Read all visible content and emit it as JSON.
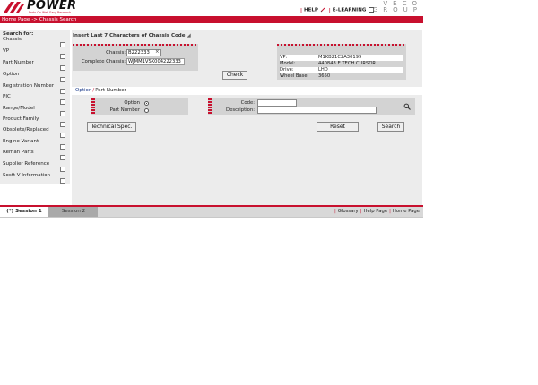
{
  "header": {
    "logo_text": "POWER",
    "logo_tagline": "Parts On Web Easy Research",
    "help_label": "HELP",
    "elearning_label": "E-LEARNING",
    "brand_logo_line1": "IVECO",
    "brand_logo_line2": "GROUP"
  },
  "breadcrumb": {
    "home": "Home Page",
    "arrow": "->",
    "current": "Chassis Search"
  },
  "sidebar": {
    "title": "Search for:",
    "items": [
      {
        "label": "Chassis"
      },
      {
        "label": "VP"
      },
      {
        "label": "Part Number"
      },
      {
        "label": "Option"
      },
      {
        "label": "Registration Number"
      },
      {
        "label": "PIC"
      },
      {
        "label": "Range/Model"
      },
      {
        "label": "Product Family"
      },
      {
        "label": "Obsolete/Replaced"
      },
      {
        "label": "Engine Variant"
      },
      {
        "label": "Reman Parts"
      },
      {
        "label": "Supplier Reference"
      },
      {
        "label": "Sostt V Information"
      }
    ]
  },
  "main": {
    "section_title": "Insert Last 7 Characters of Chassis Code",
    "chassis_label": "Chassis:",
    "chassis_value": "B222333",
    "clear_symbol": "×",
    "complete_chassis_label": "Complete Chassis:",
    "complete_chassis_value": "WJMM1VSK004222333",
    "check_button": "Check",
    "vehicle_info": [
      {
        "key": "VP:",
        "value": "M1KB21C2A30199"
      },
      {
        "key": "Model:",
        "value": "440843 E.TECH CURSOR"
      },
      {
        "key": "Drive:",
        "value": "LHD"
      },
      {
        "key": "Wheel Base:",
        "value": "3650"
      }
    ]
  },
  "subsection": {
    "tab_option": "Option",
    "separator": "/",
    "tab_part_number": "Part Number",
    "radio_option_label": "Option",
    "radio_part_number_label": "Part Number",
    "selected_radio": "Option",
    "code_label": "Code:",
    "code_value": "",
    "description_label": "Description:",
    "description_value": ""
  },
  "actions": {
    "technical_spec": "Technical Spec.",
    "reset": "Reset",
    "search": "Search"
  },
  "footer": {
    "tabs": [
      {
        "label": "(*) Session 1",
        "active": true
      },
      {
        "label": "Session 2",
        "active": false
      }
    ],
    "links": [
      "Glossary",
      "Help Page",
      "Home Page"
    ]
  },
  "colors": {
    "brand_red": "#c8102e",
    "panel_gray": "#d3d3d3",
    "background_gray": "#ececec"
  }
}
